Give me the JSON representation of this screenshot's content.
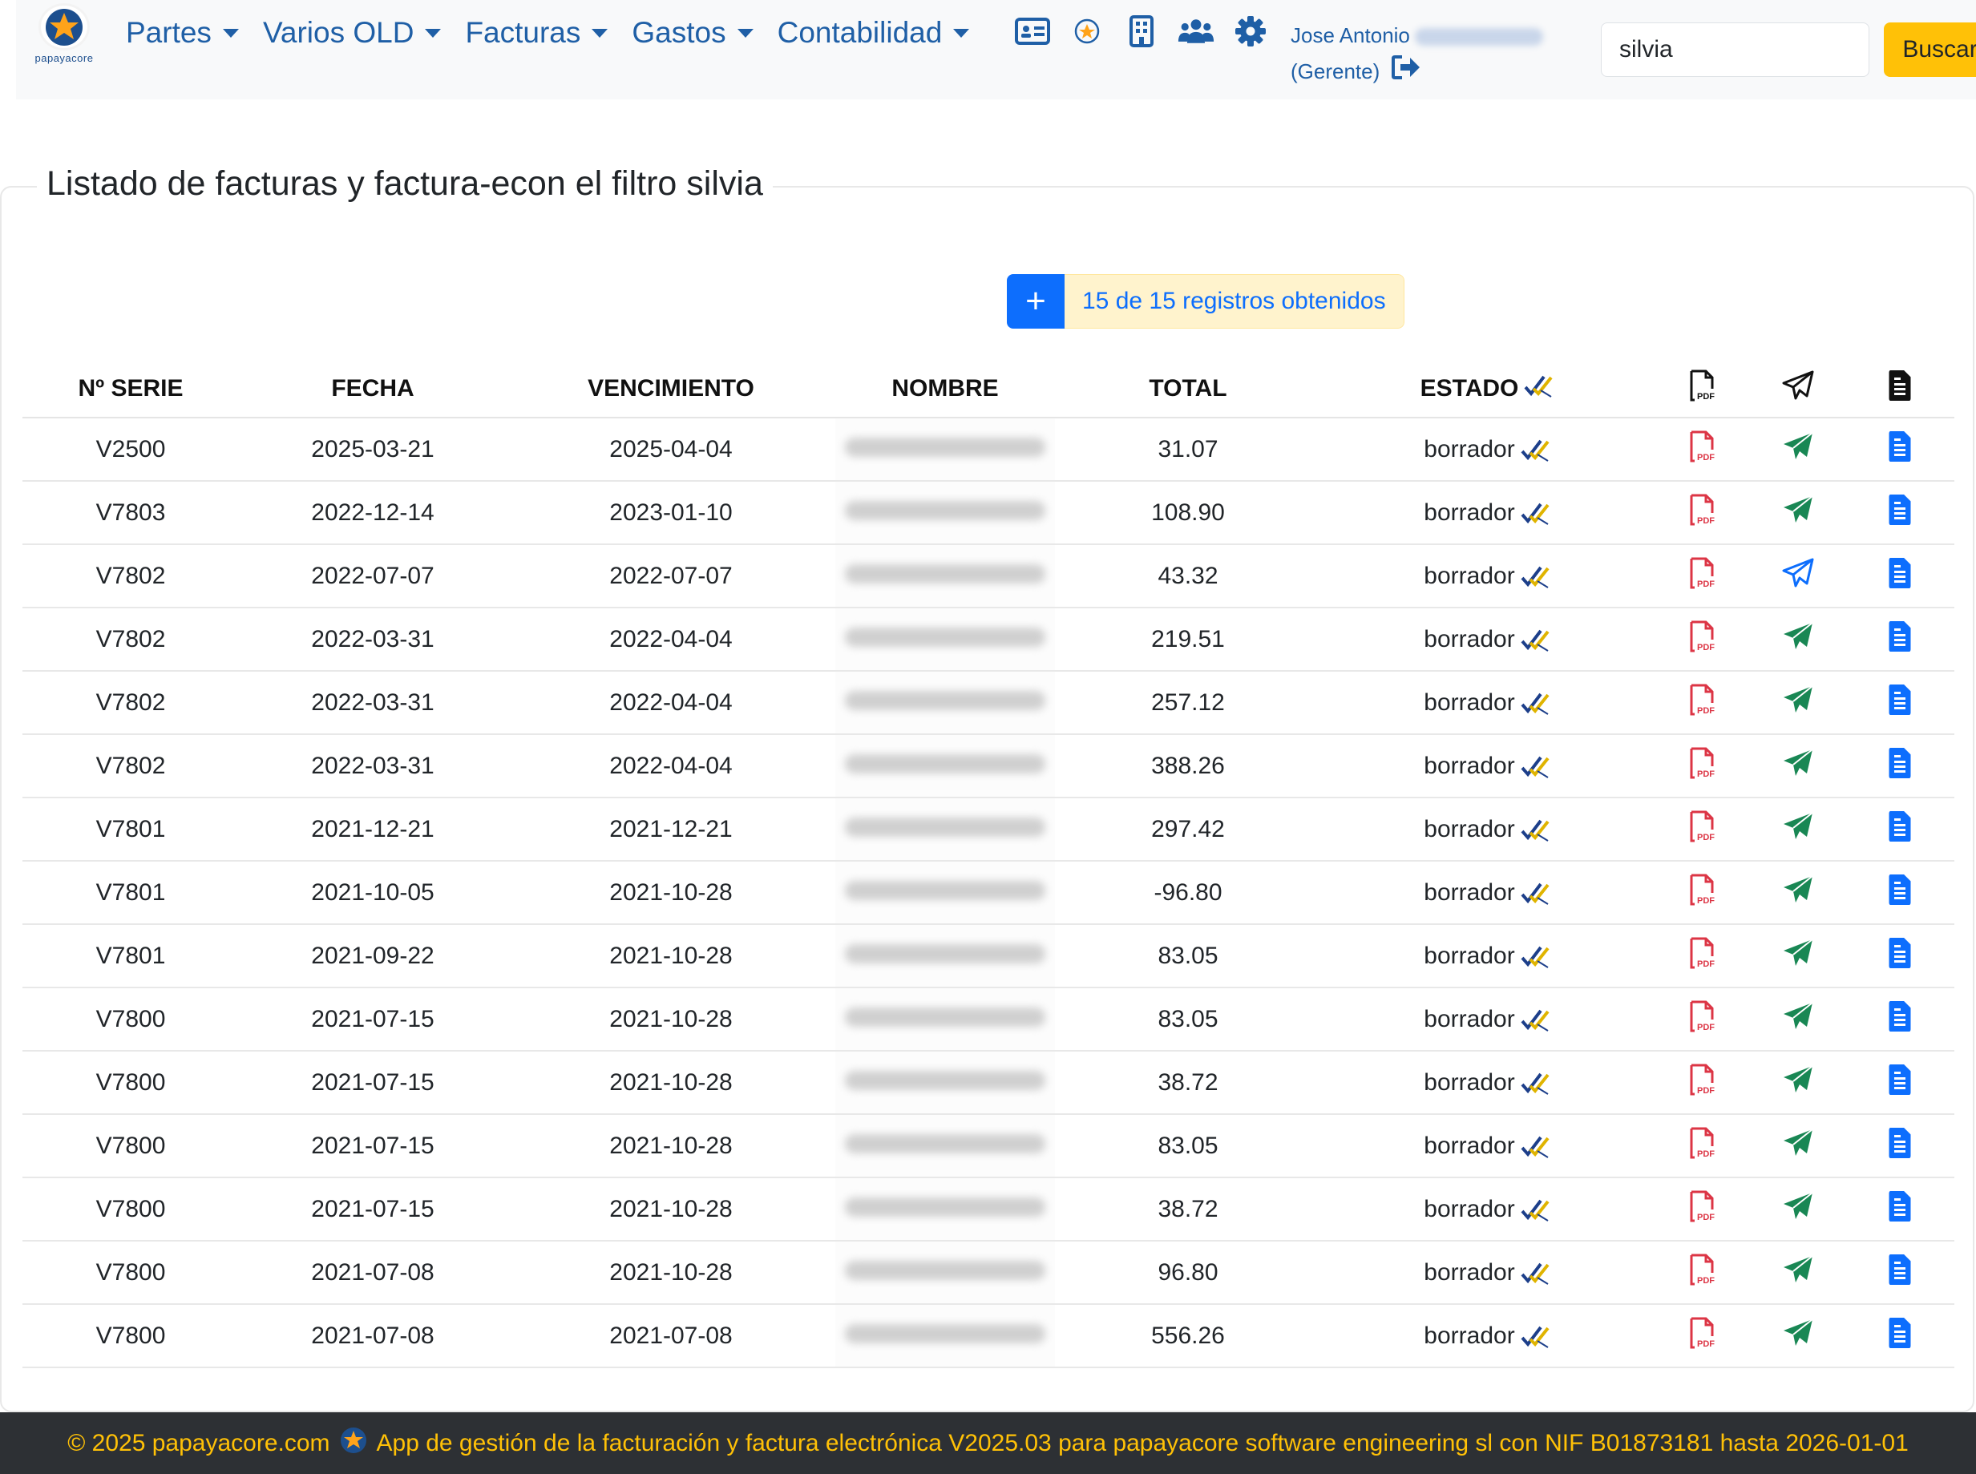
{
  "nav": {
    "logo_text": "papayacore",
    "menu": [
      {
        "label": "Partes"
      },
      {
        "label": "Varios OLD"
      },
      {
        "label": "Facturas"
      },
      {
        "label": "Gastos"
      },
      {
        "label": "Contabilidad"
      }
    ],
    "icons": [
      "id-card-icon",
      "star-badge-icon",
      "building-icon",
      "users-icon",
      "gear-icon"
    ],
    "user_name": "Jose Antonio",
    "user_role": "(Gerente)",
    "search_value": "silvia",
    "search_button": "Buscar"
  },
  "page": {
    "title": "Listado de facturas y factura-econ el filtro silvia",
    "records_info": "15 de 15 registros obtenidos",
    "add_button": "+"
  },
  "table": {
    "headers": {
      "serie": "Nº SERIE",
      "fecha": "FECHA",
      "vencimiento": "VENCIMIENTO",
      "nombre": "NOMBRE",
      "total": "TOTAL",
      "estado": "ESTADO"
    },
    "header_icons": [
      "pdf-icon",
      "send-icon",
      "document-icon"
    ],
    "rows": [
      {
        "serie": "V2500",
        "fecha": "2025-03-21",
        "vencimiento": "2025-04-04",
        "total": "31.07",
        "estado": "borrador",
        "sent": true
      },
      {
        "serie": "V7803",
        "fecha": "2022-12-14",
        "vencimiento": "2023-01-10",
        "total": "108.90",
        "estado": "borrador",
        "sent": true
      },
      {
        "serie": "V7802",
        "fecha": "2022-07-07",
        "vencimiento": "2022-07-07",
        "total": "43.32",
        "estado": "borrador",
        "sent": false
      },
      {
        "serie": "V7802",
        "fecha": "2022-03-31",
        "vencimiento": "2022-04-04",
        "total": "219.51",
        "estado": "borrador",
        "sent": true
      },
      {
        "serie": "V7802",
        "fecha": "2022-03-31",
        "vencimiento": "2022-04-04",
        "total": "257.12",
        "estado": "borrador",
        "sent": true
      },
      {
        "serie": "V7802",
        "fecha": "2022-03-31",
        "vencimiento": "2022-04-04",
        "total": "388.26",
        "estado": "borrador",
        "sent": true
      },
      {
        "serie": "V7801",
        "fecha": "2021-12-21",
        "vencimiento": "2021-12-21",
        "total": "297.42",
        "estado": "borrador",
        "sent": true
      },
      {
        "serie": "V7801",
        "fecha": "2021-10-05",
        "vencimiento": "2021-10-28",
        "total": "-96.80",
        "estado": "borrador",
        "sent": true
      },
      {
        "serie": "V7801",
        "fecha": "2021-09-22",
        "vencimiento": "2021-10-28",
        "total": "83.05",
        "estado": "borrador",
        "sent": true
      },
      {
        "serie": "V7800",
        "fecha": "2021-07-15",
        "vencimiento": "2021-10-28",
        "total": "83.05",
        "estado": "borrador",
        "sent": true
      },
      {
        "serie": "V7800",
        "fecha": "2021-07-15",
        "vencimiento": "2021-10-28",
        "total": "38.72",
        "estado": "borrador",
        "sent": true
      },
      {
        "serie": "V7800",
        "fecha": "2021-07-15",
        "vencimiento": "2021-10-28",
        "total": "83.05",
        "estado": "borrador",
        "sent": true
      },
      {
        "serie": "V7800",
        "fecha": "2021-07-15",
        "vencimiento": "2021-10-28",
        "total": "38.72",
        "estado": "borrador",
        "sent": true
      },
      {
        "serie": "V7800",
        "fecha": "2021-07-08",
        "vencimiento": "2021-10-28",
        "total": "96.80",
        "estado": "borrador",
        "sent": true
      },
      {
        "serie": "V7800",
        "fecha": "2021-07-08",
        "vencimiento": "2021-07-08",
        "total": "556.26",
        "estado": "borrador",
        "sent": true
      }
    ]
  },
  "colors": {
    "brand_blue": "#1f5fa6",
    "primary": "#0d6efd",
    "warning": "#ffc107",
    "pdf_red": "#dc3545",
    "send_green": "#198754",
    "footer_bg": "#2d3034"
  },
  "footer": {
    "copyright": "© 2025 papayacore.com",
    "text": "App de gestión de la facturación y factura electrónica V2025.03 para papayacore software engineering sl con NIF B01873181 hasta 2026-01-01"
  }
}
